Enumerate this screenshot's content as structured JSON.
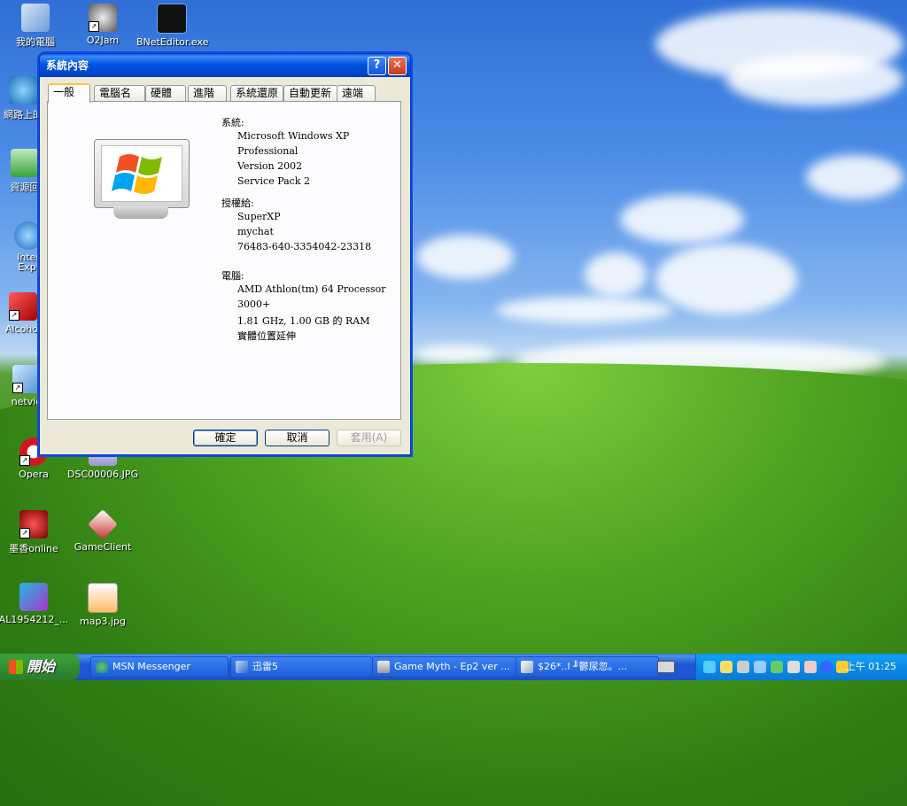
{
  "desktop": {
    "icons": [
      {
        "label": "我的電腦"
      },
      {
        "label": "O2Jam"
      },
      {
        "label": "BNetEditor.exe"
      },
      {
        "label": "網路上的"
      },
      {
        "label": "資源回"
      },
      {
        "label": "Inter\nExpl"
      },
      {
        "label": "Alcohol"
      },
      {
        "label": "netvig"
      },
      {
        "label": "Opera"
      },
      {
        "label": "DSC00006.JPG"
      },
      {
        "label": "墨香online"
      },
      {
        "label": "GameClient"
      },
      {
        "label": "AL1954212_..."
      },
      {
        "label": "map3.jpg"
      }
    ]
  },
  "dialog": {
    "title": "系統內容",
    "help_glyph": "?",
    "close_glyph": "✕",
    "tabs": [
      "一般",
      "電腦名稱",
      "硬體",
      "進階",
      "系統還原",
      "自動更新",
      "遠端"
    ],
    "system_header": "系統:",
    "system_lines": [
      "Microsoft Windows XP",
      "Professional",
      "Version 2002",
      "Service Pack 2"
    ],
    "registered_header": "授權給:",
    "registered_lines": [
      "SuperXP",
      "mychat",
      "76483-640-3354042-23318"
    ],
    "computer_header": "電腦:",
    "computer_lines": [
      "AMD Athlon(tm) 64 Processor",
      "3000+",
      "1.81 GHz, 1.00 GB 的 RAM",
      "實體位置延伸"
    ],
    "ok_label": "確定",
    "cancel_label": "取消",
    "apply_label": "套用(A)"
  },
  "taskbar": {
    "start_label": "開始",
    "tasks": [
      "MSN Messenger",
      "迅雷5",
      "Game Myth - Ep2 ver ...",
      "$26*..l ╜鬱尿忽。..."
    ],
    "clock": "上午 01:25"
  }
}
